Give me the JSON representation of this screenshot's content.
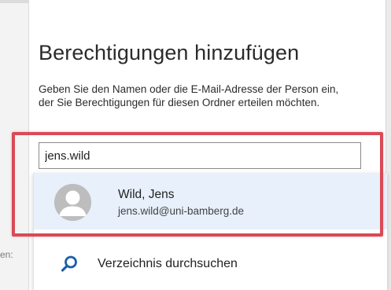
{
  "dialog": {
    "title": "Berechtigungen hinzufügen",
    "description": "Geben Sie den Namen oder die E-Mail-Adresse der Person ein, der Sie Berechtigungen für diesen Ordner erteilen möchten."
  },
  "search": {
    "value": "jens.wild"
  },
  "suggestion": {
    "name": "Wild, Jens",
    "email": "jens.wild@uni-bamberg.de",
    "icon": "person-avatar-icon"
  },
  "directory_search": {
    "label": "Verzeichnis durchsuchen",
    "icon": "search-icon"
  },
  "background": {
    "partial_label": "en:"
  },
  "colors": {
    "highlight": "#d94a57",
    "selection": "#e7f0fb",
    "accent": "#1b5faa"
  }
}
